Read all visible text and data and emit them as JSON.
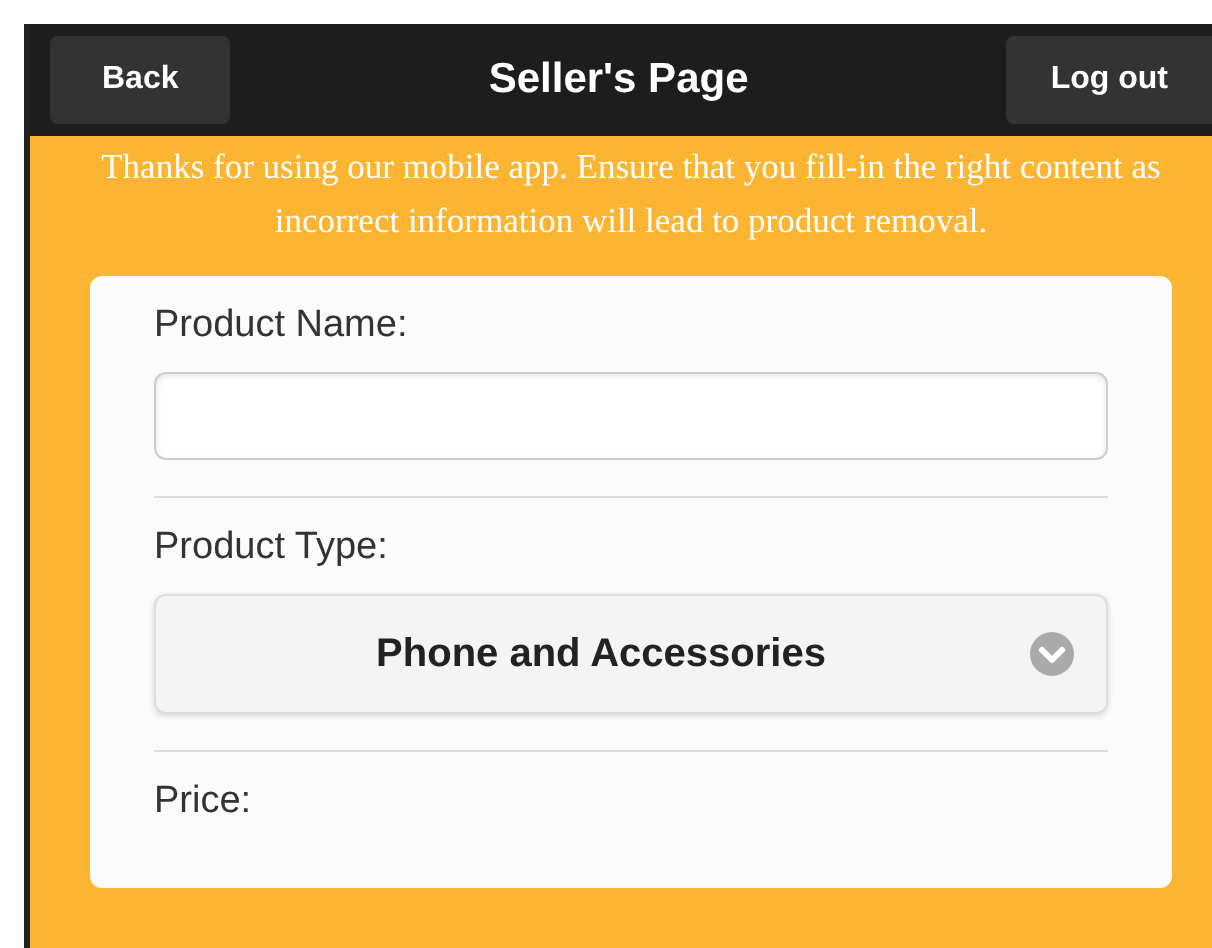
{
  "header": {
    "back_button": "Back",
    "title": "Seller's Page",
    "logout_button": "Log out"
  },
  "notice": "Thanks for using our mobile app. Ensure that you fill-in the right content as incorrect information will lead to product removal.",
  "form": [
    {
      "kind": "text",
      "label": "Product Name:"
    },
    {
      "kind": "select",
      "label": "Product Type:",
      "value": "Phone and Accessories"
    },
    {
      "kind": "label",
      "label": "Price:"
    }
  ]
}
